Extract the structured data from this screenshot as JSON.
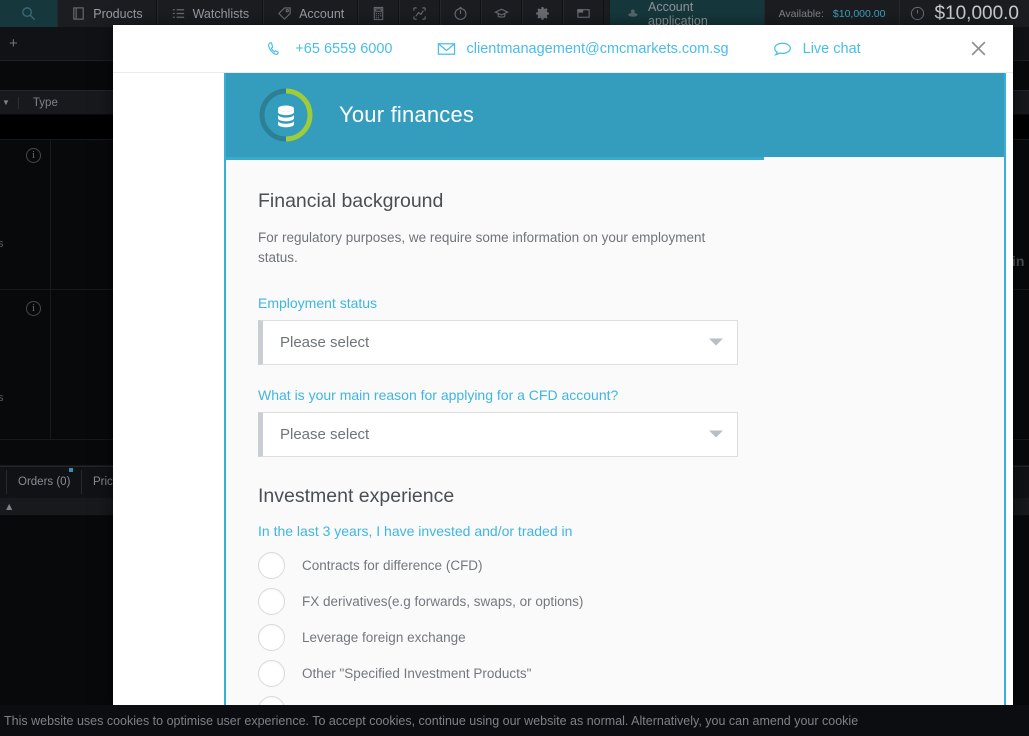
{
  "app": {
    "toolbar": {
      "search_icon": "search-icon",
      "items": [
        {
          "label": "Products",
          "icon": "book-icon"
        },
        {
          "label": "Watchlists",
          "icon": "list-icon"
        },
        {
          "label": "Account",
          "icon": "tag-icon"
        }
      ],
      "icon_buttons": [
        "calculator-icon",
        "chart-expand-icon",
        "clock-icon",
        "graduation-cap-icon",
        "gear-icon",
        "window-icon"
      ],
      "app_badge": {
        "label": "Account application",
        "icon": "cloud-icon"
      },
      "available_label": "Available:",
      "available_value": "$10,000.00",
      "balance_value": "$10,000.0",
      "balance_icon": "info-circle-icon"
    },
    "add_button": "+",
    "column_header": {
      "caret": "▼",
      "type_label": "Type"
    },
    "info_icon": "i",
    "lower_tabs": [
      {
        "label": "Orders (0)",
        "has_dot": true
      },
      {
        "label": "Price",
        "has_dot": false
      }
    ],
    "side_text_fragment": "in",
    "row_label_fragment": "s"
  },
  "cookie_banner": {
    "text": "This website uses cookies to optimise user experience. To accept cookies, continue using our website as normal. Alternatively, you can amend your cookie"
  },
  "modal": {
    "close_icon": "close-icon",
    "contact": [
      {
        "icon": "phone-icon",
        "label": "+65 6559 6000"
      },
      {
        "icon": "envelope-icon",
        "label": "clientmanagement@cmcmarkets.com.sg"
      },
      {
        "icon": "chat-bubble-icon",
        "label": "Live chat"
      }
    ],
    "header": {
      "title": "Your finances",
      "icon": "coin-stack-icon",
      "bg_color": "#349dbe",
      "ring_track_color": "#2d7f93",
      "ring_progress_color": "#9fcc3b"
    },
    "sections": [
      {
        "title": "Financial background",
        "description": "For regulatory purposes, we require some information on your employment status.",
        "fields": [
          {
            "label": "Employment status",
            "type": "select",
            "value": "Please select",
            "placeholder": "Please select"
          },
          {
            "label": "What is your main reason for applying for a CFD account?",
            "type": "select",
            "value": "Please select",
            "placeholder": "Please select"
          }
        ]
      },
      {
        "title": "Investment experience",
        "question": "In the last 3 years, I have invested and/or traded in",
        "options": [
          {
            "label": "Contracts for difference (CFD)",
            "checked": false
          },
          {
            "label": "FX derivatives(e.g forwards, swaps, or options)",
            "checked": false
          },
          {
            "label": "Leverage foreign exchange",
            "checked": false
          },
          {
            "label": "Other \"Specified Investment Products\"",
            "checked": false
          },
          {
            "label": "",
            "checked": false
          }
        ]
      }
    ]
  },
  "colors": {
    "accent_teal": "#349dbe",
    "link_blue": "#3fb6e0",
    "contact_blue": "#49bde8",
    "panel_border": "#35b0d6",
    "green": "#9fcc3b",
    "app_dark": "#08090b"
  }
}
